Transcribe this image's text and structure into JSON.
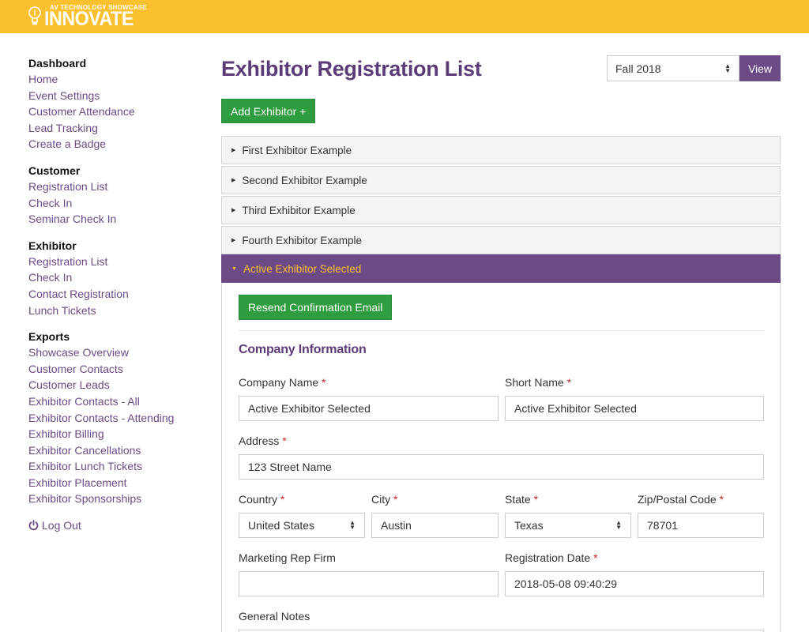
{
  "header": {
    "logo_small": "AV TECHNOLOGY SHOWCASE",
    "logo_big": "INNOVATE",
    "bg_color": "#fbc02d"
  },
  "sidebar": {
    "sections": [
      {
        "heading": "Dashboard",
        "items": [
          "Home",
          "Event Settings",
          "Customer Attendance",
          "Lead Tracking",
          "Create a Badge"
        ]
      },
      {
        "heading": "Customer",
        "items": [
          "Registration List",
          "Check In",
          "Seminar Check In"
        ]
      },
      {
        "heading": "Exhibitor",
        "items": [
          "Registration List",
          "Check In",
          "Contact Registration",
          "Lunch Tickets"
        ]
      },
      {
        "heading": "Exports",
        "items": [
          "Showcase Overview",
          "Customer Contacts",
          "Customer Leads",
          "Exhibitor Contacts - All",
          "Exhibitor Contacts - Attending",
          "Exhibitor Billing",
          "Exhibitor Cancellations",
          "Exhibitor Lunch Tickets",
          "Exhibitor Placement",
          "Exhibitor Sponsorships"
        ]
      }
    ],
    "logout_label": "Log Out",
    "logout_icon": "power-icon",
    "link_color": "#6b4a85"
  },
  "main": {
    "title": "Exhibitor Registration List",
    "season_select": {
      "value": "Fall 2018"
    },
    "view_label": "View",
    "add_label": "Add Exhibitor +",
    "exhibitors": [
      "First Exhibitor Example",
      "Second Exhibitor Example",
      "Third Exhibitor Example",
      "Fourth Exhibitor Example"
    ],
    "active_exhibitor": "Active Exhibitor Selected",
    "accent_color": "#6b4a85",
    "button_color": "#2e9d3f"
  },
  "form": {
    "resend_label": "Resend Confirmation Email",
    "section_title": "Company Information",
    "required_mark": "*",
    "company_name": {
      "label": "Company Name",
      "value": "Active Exhibitor Selected"
    },
    "short_name": {
      "label": "Short Name",
      "value": "Active Exhibitor Selected"
    },
    "address": {
      "label": "Address",
      "value": "123 Street Name"
    },
    "country": {
      "label": "Country",
      "value": "United States"
    },
    "city": {
      "label": "City",
      "value": "Austin"
    },
    "state": {
      "label": "State",
      "value": "Texas"
    },
    "zip": {
      "label": "Zip/Postal Code",
      "value": "78701"
    },
    "marketing_rep": {
      "label": "Marketing Rep Firm",
      "value": ""
    },
    "registration_date": {
      "label": "Registration Date",
      "value": "2018-05-08 09:40:29"
    },
    "general_notes": {
      "label": "General Notes"
    }
  }
}
